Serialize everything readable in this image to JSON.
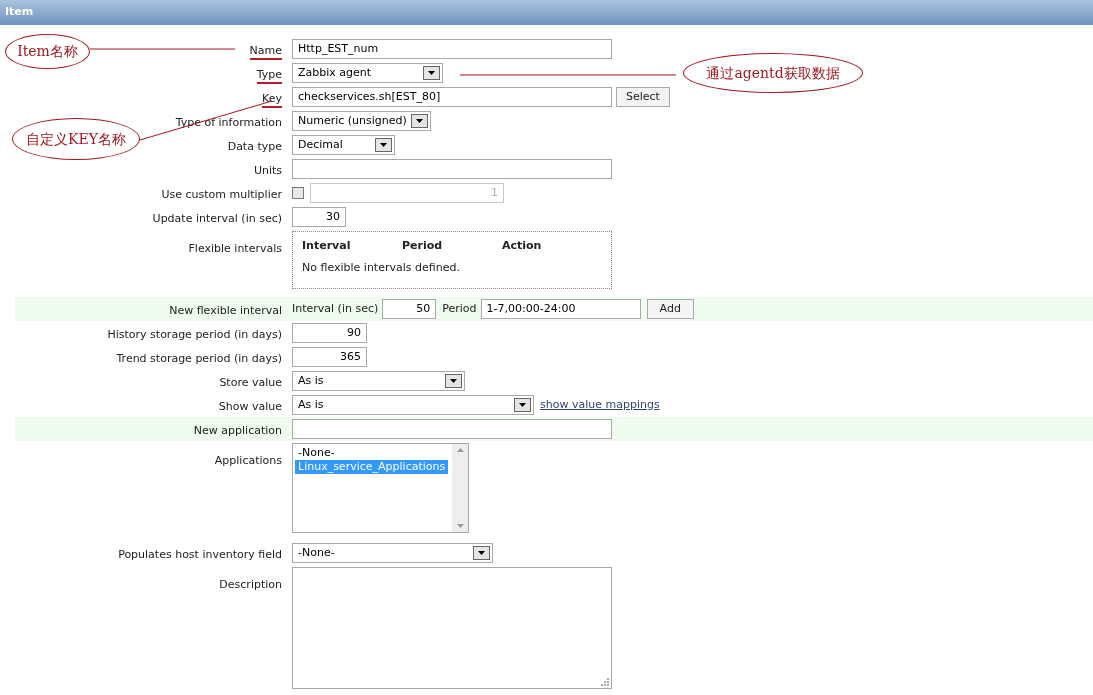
{
  "header": {
    "title": "Item"
  },
  "rows": [
    {
      "kind": "text",
      "label": "Name",
      "value": "Http_EST_num",
      "underlined": true
    },
    {
      "kind": "select",
      "label": "Type",
      "value": "Zabbix agent",
      "underlined": true
    },
    {
      "kind": "text_button",
      "label": "Key",
      "value": "checkservices.sh[EST_80]",
      "button": "Select",
      "underlined": true
    },
    {
      "kind": "select",
      "label": "Type of information",
      "value": "Numeric (unsigned)"
    },
    {
      "kind": "select",
      "label": "Data type",
      "value": "Decimal"
    },
    {
      "kind": "text",
      "label": "Units"
    },
    {
      "kind": "checkbox_text",
      "label": "Use custom multiplier",
      "checked": false,
      "value": "1",
      "disabled": true
    },
    {
      "kind": "number",
      "label": "Update interval (in sec)",
      "value": "30"
    },
    {
      "kind": "intervals",
      "label": "Flexible intervals",
      "columns": [
        "Interval",
        "Period",
        "Action"
      ],
      "empty_text": "No flexible intervals defined."
    },
    {
      "kind": "new_interval",
      "label": "New flexible interval",
      "highlighted": true,
      "interval_label": "Interval (in sec)",
      "interval": "50",
      "period_label": "Period",
      "period": "1-7,00:00-24:00",
      "button": "Add"
    },
    {
      "kind": "number",
      "label": "History storage period (in days)",
      "value": "90"
    },
    {
      "kind": "number",
      "label": "Trend storage period (in days)",
      "value": "365"
    },
    {
      "kind": "select",
      "label": "Store value",
      "value": "As is"
    },
    {
      "kind": "select",
      "label": "Show value",
      "value": "As is",
      "link": "show value mappings"
    },
    {
      "kind": "text",
      "label": "New application",
      "highlighted": true
    },
    {
      "kind": "listbox",
      "label": "Applications",
      "items": [
        {
          "text": "-None-",
          "selected": false
        },
        {
          "text": "Linux_service_Applications",
          "selected": true
        }
      ]
    },
    {
      "kind": "select",
      "label": "Populates host inventory field",
      "value": "-None-"
    },
    {
      "kind": "textarea",
      "label": "Description"
    }
  ],
  "annotations": [
    {
      "text": "Item名称"
    },
    {
      "text": "通过agentd获取数据"
    },
    {
      "text": "自定义KEY名称"
    }
  ]
}
